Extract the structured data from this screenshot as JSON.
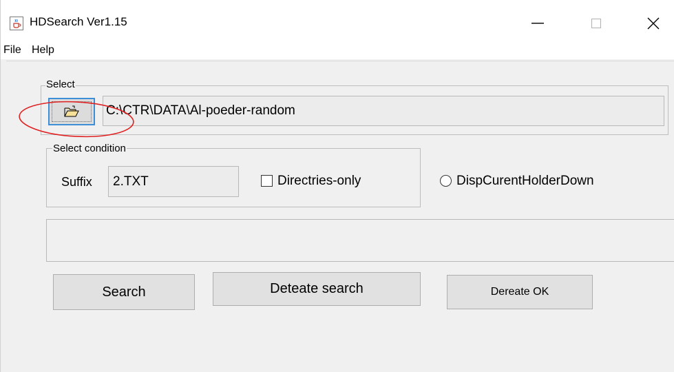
{
  "window": {
    "title": "HDSearch Ver1.15",
    "icon": "java-cup-icon",
    "controls": {
      "minimize": "—",
      "maximize": "☐",
      "close": "✕"
    }
  },
  "menu": {
    "items": [
      {
        "label": "File"
      },
      {
        "label": "Help"
      }
    ]
  },
  "select_group": {
    "label": "Select",
    "folder_button_icon": "open-folder-icon",
    "path_value": "C:\\CTR\\DATA\\Al-poeder-random"
  },
  "condition_group": {
    "label": "Select condition",
    "suffix_label": "Suffix",
    "suffix_value": "2.TXT",
    "checkbox_label": "Directries-only",
    "checkbox_checked": false
  },
  "radio": {
    "label": "DispCurentHolderDown",
    "selected": false
  },
  "message_area": {
    "text": ""
  },
  "buttons": {
    "search": "Search",
    "deteate_search": "Deteate search",
    "dereate_ok": "Dereate OK"
  },
  "annotation": {
    "color": "#e02020"
  }
}
